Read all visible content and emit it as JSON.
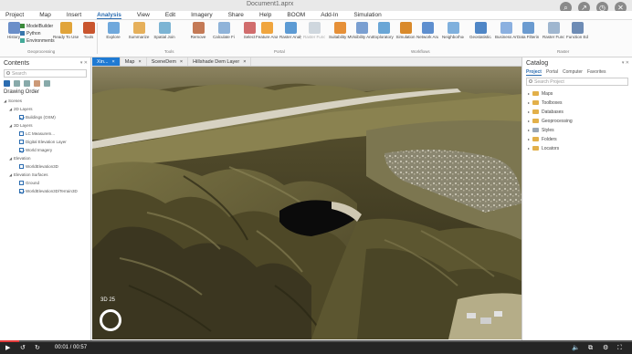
{
  "window": {
    "title": "Document1.aprx"
  },
  "player_top_icons": [
    "search-icon",
    "share-icon",
    "clock-icon",
    "close-icon"
  ],
  "ribbon_tabs": [
    "Project",
    "Map",
    "Insert",
    "Analysis",
    "View",
    "Edit",
    "Imagery",
    "Share",
    "Help",
    "BOOM",
    "Add-In",
    "Simulation"
  ],
  "active_ribbon_tab": "Analysis",
  "ribbon": {
    "history": "History",
    "modelbuilder": "ModelBuilder",
    "python": "Python",
    "environments": "Environments",
    "ready_to_use": "Ready To Use Tools",
    "tools": "Tools",
    "geoprocessing_group": "Geoprocessing",
    "buttons": [
      {
        "label": "Explore",
        "dim": false
      },
      {
        "label": "Summarize",
        "dim": false
      },
      {
        "label": "Spatial Join",
        "dim": false
      },
      {
        "label": "Remove",
        "dim": false
      },
      {
        "label": "Calculate Field",
        "dim": false
      },
      {
        "label": "Select",
        "dim": false
      },
      {
        "label": "Feature Analysis",
        "dim": false
      },
      {
        "label": "Raster Analysis",
        "dim": false
      },
      {
        "label": "Raster Functions",
        "dim": true
      },
      {
        "label": "Suitability Modeler",
        "dim": false
      },
      {
        "label": "Visibility Analysis",
        "dim": false
      },
      {
        "label": "Exploratory 3D Analysis",
        "dim": false
      },
      {
        "label": "Simulation",
        "dim": false
      },
      {
        "label": "Network Analysis",
        "dim": false
      },
      {
        "label": "Neighborhood Explorer",
        "dim": false
      },
      {
        "label": "Geostatistical Wizard",
        "dim": false
      },
      {
        "label": "Business Analysis",
        "dim": false
      },
      {
        "label": "Data Filtering",
        "dim": false
      },
      {
        "label": "Raster Functions",
        "dim": false
      },
      {
        "label": "Function Editor",
        "dim": false
      }
    ],
    "groups": [
      "Geoprocessing",
      "Tools",
      "Portal",
      "Workflows",
      "Raster"
    ]
  },
  "contents": {
    "title": "Contents",
    "search_placeholder": "Search",
    "drawing_order": "Drawing Order",
    "tree": [
      {
        "label": "Scenes",
        "indent": 0,
        "arrow": "◢",
        "cb": false
      },
      {
        "label": "2D Layers",
        "indent": 1,
        "arrow": "◢",
        "cb": false
      },
      {
        "label": "Buildings (OSM)",
        "indent": 2,
        "arrow": "",
        "cb": true
      },
      {
        "label": "3D Layers",
        "indent": 1,
        "arrow": "◢",
        "cb": false
      },
      {
        "label": "LC Measurem...",
        "indent": 2,
        "arrow": "",
        "cb": false
      },
      {
        "label": "Digital Elevation Layer",
        "indent": 2,
        "arrow": "",
        "cb": false
      },
      {
        "label": "World Imagery",
        "indent": 2,
        "arrow": "",
        "cb": true
      },
      {
        "label": "Elevation",
        "indent": 1,
        "arrow": "◢",
        "cb": false
      },
      {
        "label": "WorldElevation3D",
        "indent": 2,
        "arrow": "",
        "cb": false
      },
      {
        "label": "Elevation Surfaces",
        "indent": 1,
        "arrow": "◢",
        "cb": false
      },
      {
        "label": "Ground",
        "indent": 2,
        "arrow": "",
        "cb": false
      },
      {
        "label": "WorldElevation3D/Terrain3D",
        "indent": 2,
        "arrow": "",
        "cb": true
      }
    ]
  },
  "map_tabs": [
    {
      "label": "Xin...",
      "active": true
    },
    {
      "label": "Map",
      "active": false
    },
    {
      "label": "SceneDem",
      "active": false
    },
    {
      "label": "Hillshade Dem Layer",
      "active": false
    }
  ],
  "map": {
    "scale_label": "3D 25"
  },
  "catalog": {
    "title": "Catalog",
    "tabs": [
      "Project",
      "Portal",
      "Computer",
      "Favorites"
    ],
    "search_placeholder": "Search Project",
    "items": [
      {
        "label": "Maps",
        "folder": "gold"
      },
      {
        "label": "Toolboxes",
        "folder": "gold"
      },
      {
        "label": "Databases",
        "folder": "gold"
      },
      {
        "label": "Geoprocessing",
        "folder": "gold"
      },
      {
        "label": "Styles",
        "folder": "gray"
      },
      {
        "label": "Folders",
        "folder": "gold"
      },
      {
        "label": "Locators",
        "folder": "gold"
      }
    ]
  },
  "player": {
    "time": "00:01 / 00:57",
    "progress": 0.03
  }
}
